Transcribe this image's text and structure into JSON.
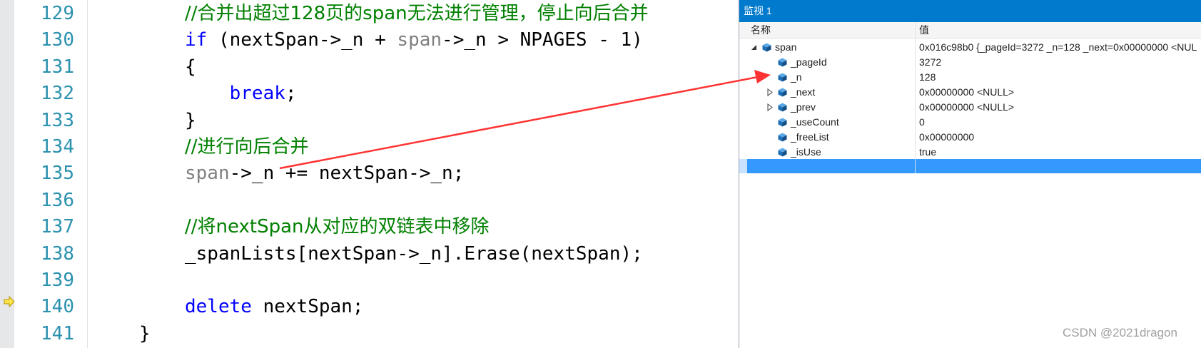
{
  "editor": {
    "lines": [
      {
        "num": "129",
        "segments": [
          {
            "cls": "cm",
            "text": "//合并出超过128页的span无法进行管理，停止向后合并"
          }
        ]
      },
      {
        "num": "130",
        "segments": [
          {
            "cls": "kw",
            "text": "if"
          },
          {
            "cls": "",
            "text": " (nextSpan->_n + "
          },
          {
            "cls": "gv",
            "text": "span"
          },
          {
            "cls": "",
            "text": "->_n > NPAGES - 1)"
          }
        ]
      },
      {
        "num": "131",
        "segments": [
          {
            "cls": "",
            "text": "{"
          }
        ]
      },
      {
        "num": "132",
        "segments": [
          {
            "cls": "kw",
            "text": "    break"
          },
          {
            "cls": "",
            "text": ";"
          }
        ]
      },
      {
        "num": "133",
        "segments": [
          {
            "cls": "",
            "text": "}"
          }
        ]
      },
      {
        "num": "134",
        "segments": [
          {
            "cls": "cm",
            "text": "//进行向后合并"
          }
        ]
      },
      {
        "num": "135",
        "segments": [
          {
            "cls": "gv",
            "text": "span"
          },
          {
            "cls": "",
            "text": "->_n += nextSpan->_n;"
          }
        ]
      },
      {
        "num": "136",
        "segments": []
      },
      {
        "num": "137",
        "segments": [
          {
            "cls": "cm",
            "text": "//将nextSpan从对应的双链表中移除"
          }
        ]
      },
      {
        "num": "138",
        "segments": [
          {
            "cls": "",
            "text": "_spanLists[nextSpan->_n].Erase(nextSpan);"
          }
        ]
      },
      {
        "num": "139",
        "segments": []
      },
      {
        "num": "140",
        "segments": [
          {
            "cls": "kw",
            "text": "delete"
          },
          {
            "cls": "",
            "text": " nextSpan;"
          }
        ]
      },
      {
        "num": "141",
        "segments": [
          {
            "cls": "",
            "text": "}"
          }
        ]
      }
    ]
  },
  "watch": {
    "title": "监视 1",
    "col_name": "名称",
    "col_value": "值",
    "rows": [
      {
        "name": "span",
        "value": "0x016c98b0 {_pageId=3272 _n=128 _next=0x00000000 <NUL",
        "expander": "expanded",
        "level": 0
      },
      {
        "name": "_pageId",
        "value": "3272",
        "expander": "none",
        "level": 1
      },
      {
        "name": "_n",
        "value": "128",
        "expander": "none",
        "level": 1
      },
      {
        "name": "_next",
        "value": "0x00000000 <NULL>",
        "expander": "collapsed",
        "level": 1
      },
      {
        "name": "_prev",
        "value": "0x00000000 <NULL>",
        "expander": "collapsed",
        "level": 1
      },
      {
        "name": "_useCount",
        "value": "0",
        "expander": "none",
        "level": 1
      },
      {
        "name": "_freeList",
        "value": "0x00000000",
        "expander": "none",
        "level": 1
      },
      {
        "name": "_isUse",
        "value": "true",
        "expander": "none",
        "level": 1
      }
    ]
  },
  "icons": {
    "exec_pointer": "execution-pointer-arrow-icon",
    "field": "field-cube-icon",
    "expanded": "expanded-triangle-icon",
    "collapsed": "collapsed-triangle-icon"
  },
  "colors": {
    "keyword": "#0000ff",
    "comment": "#008000",
    "line_number": "#2b91af",
    "watch_title_bar": "#007acc",
    "selected_row": "#3399ff",
    "annotation_arrow": "#ff3333"
  },
  "watermark": "CSDN @2021dragon"
}
